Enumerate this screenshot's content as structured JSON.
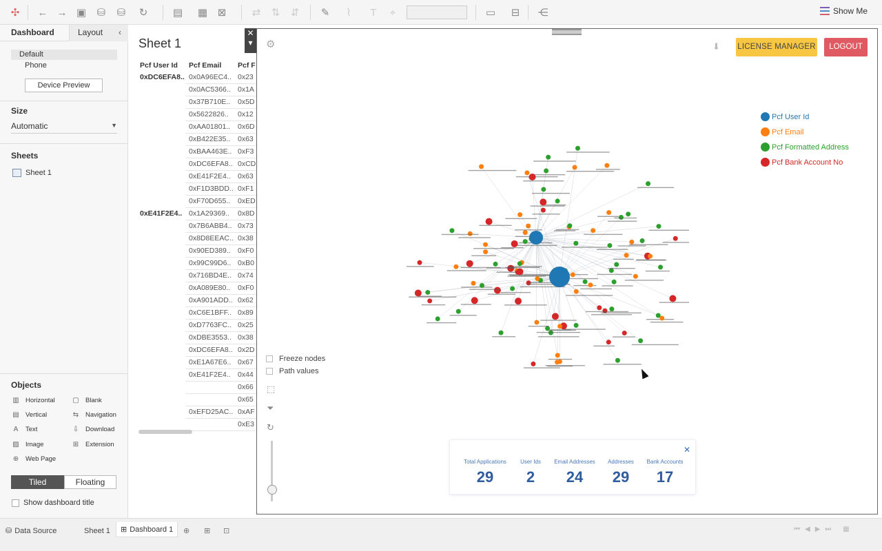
{
  "toolbar": {
    "show_me_label": "Show Me",
    "icons": [
      "tableau-logo-icon",
      "undo-icon",
      "redo-icon",
      "save-icon",
      "new-datasource-icon",
      "pause-icon",
      "refresh-icon",
      "new-worksheet-icon",
      "duplicate-icon",
      "clear-icon",
      "swap-icon",
      "sort-asc-icon",
      "sort-desc-icon",
      "highlight-icon",
      "group-icon",
      "label-icon",
      "fix-axes-icon",
      "fit-dropdown",
      "view-cards-icon",
      "presentation-icon",
      "share-icon"
    ]
  },
  "left_pane": {
    "tabs": {
      "dashboard": "Dashboard",
      "layout": "Layout"
    },
    "device": {
      "default": "Default",
      "phone": "Phone",
      "preview_button": "Device Preview"
    },
    "size": {
      "title": "Size",
      "value": "Automatic"
    },
    "sheets": {
      "title": "Sheets",
      "items": [
        "Sheet 1"
      ]
    },
    "objects": {
      "title": "Objects",
      "items": [
        {
          "label": "Horizontal",
          "icon": "horizontal-icon"
        },
        {
          "label": "Blank",
          "icon": "blank-icon"
        },
        {
          "label": "Vertical",
          "icon": "vertical-icon"
        },
        {
          "label": "Navigation",
          "icon": "navigation-icon"
        },
        {
          "label": "Text",
          "icon": "text-icon"
        },
        {
          "label": "Download",
          "icon": "download-icon"
        },
        {
          "label": "Image",
          "icon": "image-icon"
        },
        {
          "label": "Extension",
          "icon": "extension-icon"
        },
        {
          "label": "Web Page",
          "icon": "webpage-icon"
        }
      ],
      "tiled": "Tiled",
      "floating": "Floating"
    },
    "show_title": "Show dashboard title"
  },
  "sheet": {
    "title": "Sheet 1",
    "columns": [
      "Pcf User Id",
      "Pcf Email",
      "Pcf F"
    ],
    "user_ids": [
      "0xDC6EFA8..",
      "0xE41F2E4.."
    ],
    "emails": [
      "0x0A96EC4..",
      "0x0AC5366..",
      "0x37B710E..",
      "0x5622826..",
      "0xAA01801..",
      "0xB422E35..",
      "0xBAA463E..",
      "0xDC6EFA8..",
      "0xE41F2E4..",
      "0xF1D3BDD..",
      "0xF70D655..",
      "0x1A29369..",
      "0x7B6ABB4..",
      "0x8D8EEAC..",
      "0x90ED389..",
      "0x99C99D6..",
      "0x716BD4E..",
      "0xA089E80..",
      "0xA901ADD..",
      "0xC6E1BFF..",
      "0xD7763FC..",
      "0xDBE3553..",
      "0xDC6EFA8..",
      "0xE1A67E6..",
      "0xE41F2E4..",
      "",
      "",
      "0xEFD25AC..",
      ""
    ],
    "formatted": [
      "0x23",
      "0x1A",
      "0x5D",
      "0x12",
      "0x6D",
      "0x63",
      "0xF3",
      "0xCD",
      "0x63",
      "0xF1",
      "0xED",
      "0x8D",
      "0x73",
      "0x38",
      "0xF0",
      "0xB0",
      "0x74",
      "0xF0",
      "0x62",
      "0x89",
      "0x25",
      "0x38",
      "0x2D",
      "0x67",
      "0x44",
      "0x66",
      "0x65",
      "0xAF",
      "0xE3"
    ]
  },
  "dashboard": {
    "license_button": "LICENSE MANAGER",
    "logout_button": "LOGOUT",
    "legend": [
      {
        "label": "Pcf User Id",
        "color": "#1f77b4"
      },
      {
        "label": "Pcf Email",
        "color": "#ff7f0e"
      },
      {
        "label": "Pcf Formatted Address",
        "color": "#2ca02c"
      },
      {
        "label": "Pcf Bank Account No",
        "color": "#d62728"
      }
    ],
    "controls": {
      "freeze": "Freeze nodes",
      "path": "Path values"
    },
    "stats": [
      {
        "label": "Total Applications",
        "value": "29"
      },
      {
        "label": "User Ids",
        "value": "2"
      },
      {
        "label": "Email Addresses",
        "value": "24"
      },
      {
        "label": "Addresses",
        "value": "29"
      },
      {
        "label": "Bank Accounts",
        "value": "17"
      }
    ]
  },
  "bottom_tabs": {
    "data_source": "Data Source",
    "sheet1": "Sheet 1",
    "dashboard1": "Dashboard 1"
  }
}
